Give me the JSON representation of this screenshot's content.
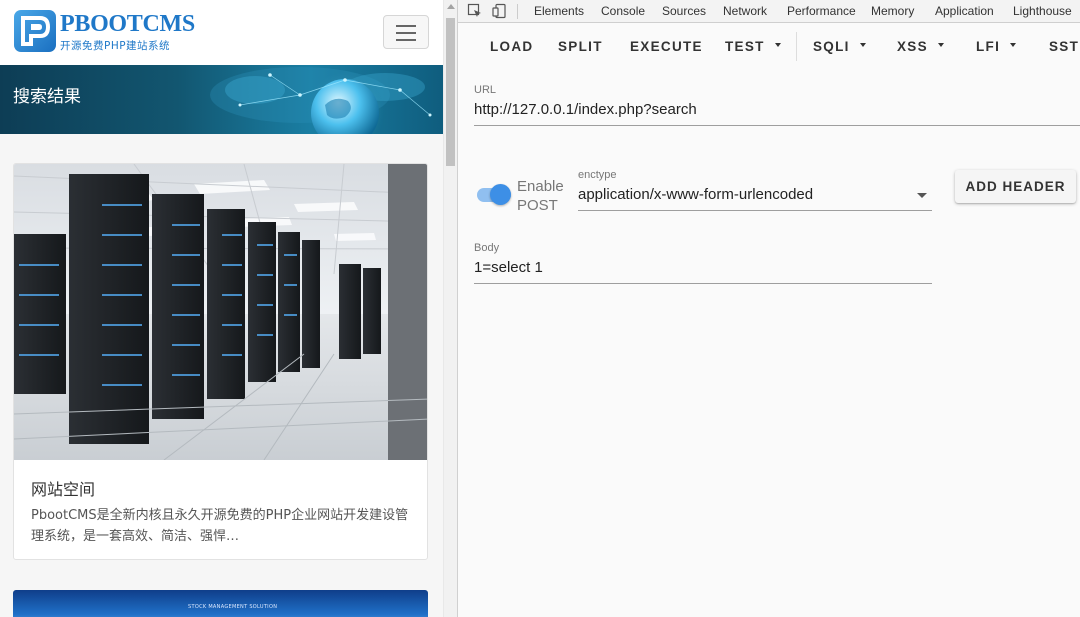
{
  "site": {
    "logo_text": "PBOOTCMS",
    "logo_subtitle": "开源免费PHP建站系统",
    "banner_title": "搜索结果",
    "card": {
      "title": "网站空间",
      "description": "PbootCMS是全新内核且永久开源免费的PHP企业网站开发建设管理系统，是一套高效、简洁、强悍…"
    },
    "card2_text": "STOCK MANAGEMENT SOLUTION"
  },
  "devtools": {
    "tabs": [
      "Elements",
      "Console",
      "Sources",
      "Network",
      "Performance",
      "Memory",
      "Application",
      "Lighthouse"
    ],
    "toolbar": {
      "load": "LOAD",
      "split": "SPLIT",
      "execute": "EXECUTE",
      "test": "TEST",
      "sqli": "SQLI",
      "xss": "XSS",
      "lfi": "LFI",
      "ssti": "SSTI"
    },
    "url_label": "URL",
    "url_value": "http://127.0.0.1/index.php?search",
    "toggle_label_1": "Enable",
    "toggle_label_2": "POST",
    "toggle_enabled": true,
    "enctype_label": "enctype",
    "enctype_value": "application/x-www-form-urlencoded",
    "add_header_label": "ADD HEADER",
    "body_label": "Body",
    "body_value": "1=select 1"
  },
  "colors": {
    "logo_blue": "#1f78c8",
    "toggle_blue": "#3d8fe6",
    "banner_dark": "#0d3d55"
  }
}
